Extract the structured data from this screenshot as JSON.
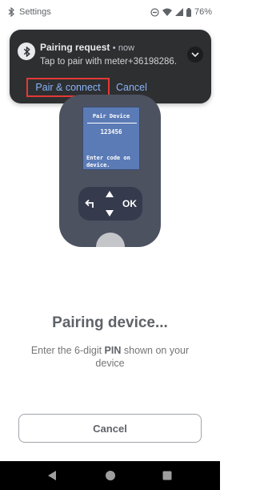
{
  "status_bar": {
    "app_label": "Settings",
    "battery": "76%"
  },
  "notification": {
    "title": "Pairing request",
    "separator": "•",
    "time": "now",
    "text": "Tap to pair with meter+36198286.",
    "actions": {
      "pair": "Pair & connect",
      "cancel": "Cancel"
    }
  },
  "device": {
    "screen_title": "Pair Device",
    "code": "123456",
    "message_line1": "Enter code on",
    "message_line2": "device.",
    "ok_key": "OK"
  },
  "main": {
    "title": "Pairing device...",
    "instructions_prefix": "Enter the 6-digit ",
    "instructions_bold": "PIN",
    "instructions_suffix": " shown on your device",
    "cancel_label": "Cancel"
  },
  "colors": {
    "notification_bg": "#2d2f31",
    "action_link": "#8ab4f8",
    "highlight": "#e53935",
    "device_body": "#4d5261",
    "device_screen": "#5b7bb6"
  },
  "icons": {
    "status_left": "bluetooth-icon",
    "status_right": [
      "do-not-disturb-icon",
      "wifi-icon",
      "signal-icon",
      "battery-icon"
    ],
    "notification": "bluetooth-icon",
    "expand": "chevron-down-icon",
    "nav": [
      "back-triangle-icon",
      "home-circle-icon",
      "recents-square-icon"
    ]
  }
}
